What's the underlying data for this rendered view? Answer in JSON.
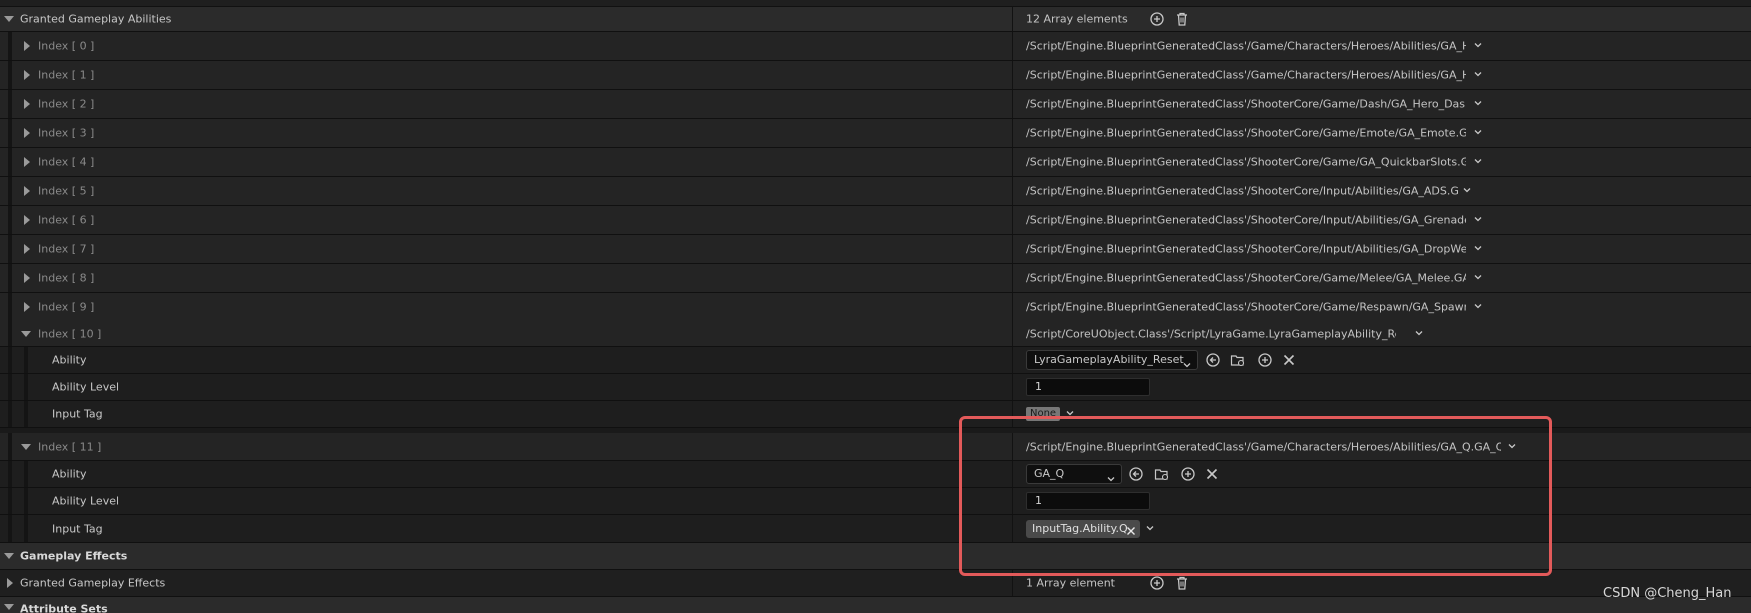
{
  "granted_abilities": {
    "label": "Granted Gameplay Abilities",
    "count_text": "12 Array elements",
    "items": [
      {
        "index": "Index [ 0 ]",
        "value": "/Script/Engine.BlueprintGeneratedClass'/Game/Characters/Heroes/Abilities/GA_Hero_Jum"
      },
      {
        "index": "Index [ 1 ]",
        "value": "/Script/Engine.BlueprintGeneratedClass'/Game/Characters/Heroes/Abilities/GA_Hero_Deat"
      },
      {
        "index": "Index [ 2 ]",
        "value": "/Script/Engine.BlueprintGeneratedClass'/ShooterCore/Game/Dash/GA_Hero_Dash.GA_Hero_"
      },
      {
        "index": "Index [ 3 ]",
        "value": "/Script/Engine.BlueprintGeneratedClass'/ShooterCore/Game/Emote/GA_Emote.GA_Emote_C"
      },
      {
        "index": "Index [ 4 ]",
        "value": "/Script/Engine.BlueprintGeneratedClass'/ShooterCore/Game/GA_QuickbarSlots.GA_Quickba"
      },
      {
        "index": "Index [ 5 ]",
        "value": "/Script/Engine.BlueprintGeneratedClass'/ShooterCore/Input/Abilities/GA_ADS.GA_ADS_C'"
      },
      {
        "index": "Index [ 6 ]",
        "value": "/Script/Engine.BlueprintGeneratedClass'/ShooterCore/Input/Abilities/GA_Grenade.GA_Grena"
      },
      {
        "index": "Index [ 7 ]",
        "value": "/Script/Engine.BlueprintGeneratedClass'/ShooterCore/Input/Abilities/GA_DropWeapon.GA_D"
      },
      {
        "index": "Index [ 8 ]",
        "value": "/Script/Engine.BlueprintGeneratedClass'/ShooterCore/Game/Melee/GA_Melee.GA_Melee_C"
      },
      {
        "index": "Index [ 9 ]",
        "value": "/Script/Engine.BlueprintGeneratedClass'/ShooterCore/Game/Respawn/GA_SpawnEffect.GA_"
      }
    ],
    "index10": {
      "index": "Index [ 10 ]",
      "value": "/Script/CoreUObject.Class'/Script/LyraGame.LyraGameplayAbility_Reset'",
      "ability_label": "Ability",
      "ability_value": "LyraGameplayAbility_Reset",
      "level_label": "Ability Level",
      "level_value": "1",
      "tag_label": "Input Tag",
      "tag_value": "None"
    },
    "index11": {
      "index": "Index [ 11 ]",
      "value": "/Script/Engine.BlueprintGeneratedClass'/Game/Characters/Heroes/Abilities/GA_Q.GA_Q_C'",
      "ability_label": "Ability",
      "ability_value": "GA_Q",
      "level_label": "Ability Level",
      "level_value": "1",
      "tag_label": "Input Tag",
      "tag_value": "InputTag.Ability.Q"
    }
  },
  "gameplay_effects": {
    "label": "Gameplay Effects",
    "granted_label": "Granted Gameplay Effects",
    "count_text": "1 Array element"
  },
  "attribute_sets": {
    "label": "Attribute Sets"
  },
  "watermark": "CSDN @Cheng_Han",
  "colors": {
    "highlight": "#e35a5a",
    "background": "#1a1a1a"
  }
}
